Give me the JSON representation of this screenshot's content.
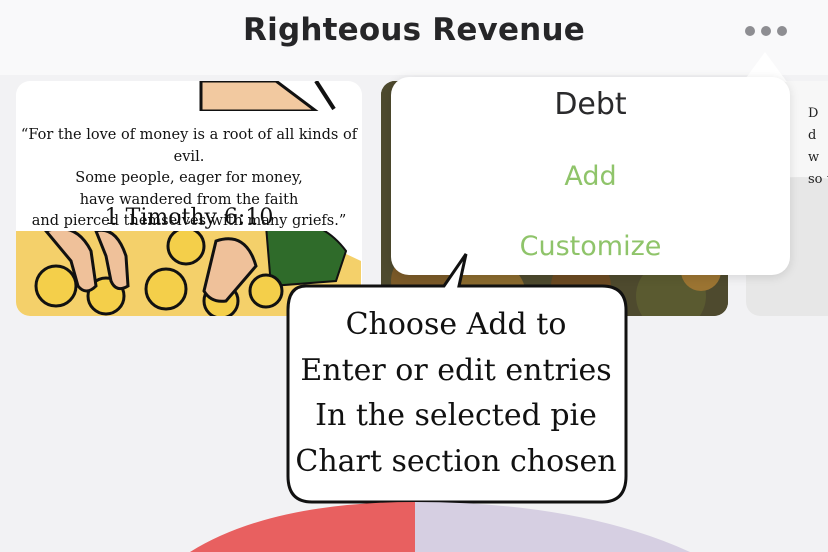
{
  "header": {
    "title": "Righteous Revenue",
    "more_icon": "ellipsis-icon"
  },
  "cards": [
    {
      "verse_lines": "“For the love of money is a root of all kinds of evil.\nSome people, eager for money,\nhave wandered from the faith\nand pierced themselves with many griefs.”",
      "reference": "1 Timothy 6:10"
    },
    {},
    {
      "verse_fragment": "D\nd\nw\nso t"
    }
  ],
  "menu": {
    "items": [
      "Debt",
      "Add",
      "Customize"
    ]
  },
  "callout": {
    "text": "Choose Add to\nEnter or edit entries\nIn the selected pie\nChart section chosen"
  },
  "colors": {
    "accent_green": "#8fc46a",
    "pie_red": "#e86060",
    "pie_lavender": "#d6cfe2"
  }
}
